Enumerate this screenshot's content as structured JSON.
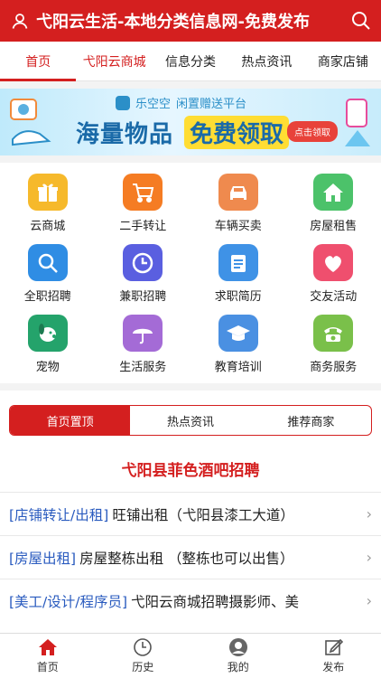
{
  "header": {
    "title": "弋阳云生活-本地分类信息网-免费发布"
  },
  "tabs": [
    {
      "label": "首页"
    },
    {
      "label": "弋阳云商城"
    },
    {
      "label": "信息分类"
    },
    {
      "label": "热点资讯"
    },
    {
      "label": "商家店铺"
    }
  ],
  "banner": {
    "brand": "乐空空",
    "slogan": "闲置赠送平台",
    "headline_1": "海量物品",
    "headline_2": "免费领取",
    "cta": "点击领取"
  },
  "grid": [
    {
      "label": "云商城",
      "icon": "gift-icon",
      "color": "#f6b92b"
    },
    {
      "label": "二手转让",
      "icon": "cart-icon",
      "color": "#f57c23"
    },
    {
      "label": "车辆买卖",
      "icon": "car-icon",
      "color": "#ef8a4e"
    },
    {
      "label": "房屋租售",
      "icon": "house-icon",
      "color": "#4cc26a"
    },
    {
      "label": "全职招聘",
      "icon": "search-person-icon",
      "color": "#2f8de4"
    },
    {
      "label": "兼职招聘",
      "icon": "clock-icon",
      "color": "#5a5fe0"
    },
    {
      "label": "求职简历",
      "icon": "resume-icon",
      "color": "#3f92e6"
    },
    {
      "label": "交友活动",
      "icon": "heart-people-icon",
      "color": "#ef4f6e"
    },
    {
      "label": "宠物",
      "icon": "dog-icon",
      "color": "#24a36b"
    },
    {
      "label": "生活服务",
      "icon": "umbrella-icon",
      "color": "#a46bd6"
    },
    {
      "label": "教育培训",
      "icon": "graduation-icon",
      "color": "#4a90e2"
    },
    {
      "label": "商务服务",
      "icon": "phone-icon",
      "color": "#7ac04a"
    }
  ],
  "segmented": [
    {
      "label": "首页置顶"
    },
    {
      "label": "热点资讯"
    },
    {
      "label": "推荐商家"
    }
  ],
  "feature": "弋阳县菲色酒吧招聘",
  "list": [
    {
      "cat": "[店铺转让/出租]",
      "text": "旺铺出租（弋阳县漆工大道）"
    },
    {
      "cat": "[房屋出租]",
      "text": "房屋整栋出租 （整栋也可以出售）"
    },
    {
      "cat": "[美工/设计/程序员]",
      "text": "弋阳云商城招聘摄影师、美"
    }
  ],
  "bottom_nav": [
    {
      "label": "首页"
    },
    {
      "label": "历史"
    },
    {
      "label": "我的"
    },
    {
      "label": "发布"
    }
  ]
}
